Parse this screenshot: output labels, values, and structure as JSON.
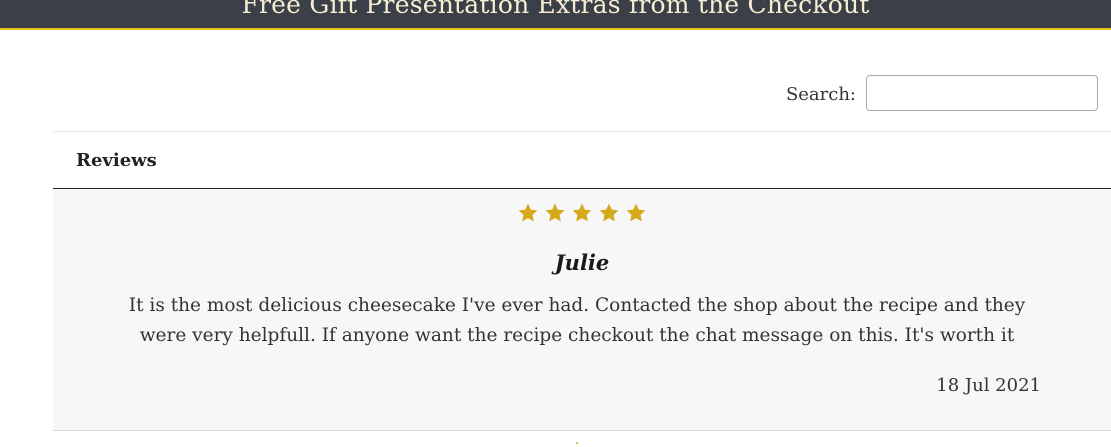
{
  "banner": {
    "title": "Free Gift Presentation Extras from the Checkout",
    "background_color": "#3b4048",
    "accent_color": "#e8c11c"
  },
  "search": {
    "label": "Search:",
    "value": "",
    "placeholder": ""
  },
  "reviews_table": {
    "header": "Reviews",
    "rows": [
      {
        "rating": 5,
        "max_rating": 5,
        "star_icon": "star-icon",
        "star_color": "#d4a91b",
        "reviewer": "Julie",
        "text": "It is the most delicious cheesecake I've ever had. Contacted the shop about the recipe and they were very helpfull. If anyone want the recipe checkout the chat message on this. It's worth it",
        "date": "18 Jul 2021"
      }
    ]
  }
}
